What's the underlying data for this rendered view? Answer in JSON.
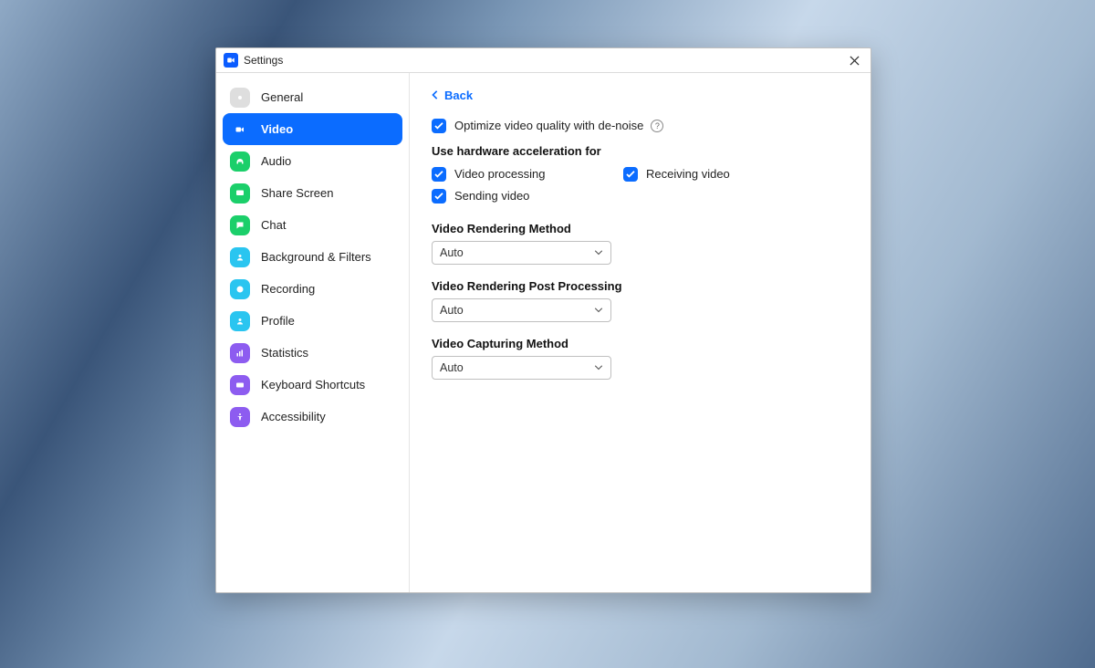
{
  "window": {
    "title": "Settings"
  },
  "sidebar": {
    "items": [
      {
        "label": "General"
      },
      {
        "label": "Video"
      },
      {
        "label": "Audio"
      },
      {
        "label": "Share Screen"
      },
      {
        "label": "Chat"
      },
      {
        "label": "Background & Filters"
      },
      {
        "label": "Recording"
      },
      {
        "label": "Profile"
      },
      {
        "label": "Statistics"
      },
      {
        "label": "Keyboard Shortcuts"
      },
      {
        "label": "Accessibility"
      }
    ],
    "active_index": 1
  },
  "content": {
    "back_label": "Back",
    "optimize": {
      "label": "Optimize video quality with de-noise",
      "checked": true
    },
    "hw_accel_heading": "Use hardware acceleration for",
    "hw_accel": {
      "video_processing": {
        "label": "Video processing",
        "checked": true
      },
      "receiving_video": {
        "label": "Receiving video",
        "checked": true
      },
      "sending_video": {
        "label": "Sending video",
        "checked": true
      }
    },
    "dropdowns": {
      "rendering_method": {
        "label": "Video Rendering Method",
        "value": "Auto"
      },
      "rendering_post": {
        "label": "Video Rendering Post Processing",
        "value": "Auto"
      },
      "capturing_method": {
        "label": "Video Capturing Method",
        "value": "Auto"
      }
    }
  }
}
